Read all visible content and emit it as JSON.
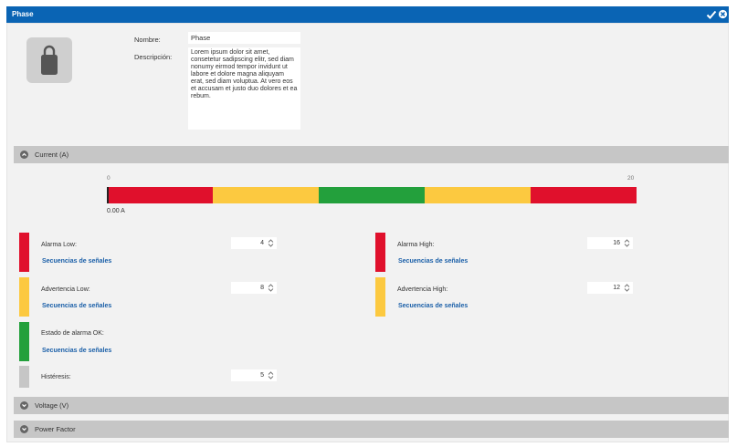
{
  "window": {
    "title": "Phase"
  },
  "colors": {
    "title_bar": "#0a64b4",
    "red": "#e0102c",
    "yellow": "#fcc940",
    "green": "#23a03c",
    "gray": "#c6c6c6",
    "link": "#1a5fa8"
  },
  "icons": {
    "device": "lock-icon",
    "confirm": "checkmark-icon",
    "close": "close-circle-icon",
    "expanded": "chevron-up-icon",
    "collapsed": "chevron-down-icon"
  },
  "form": {
    "name_label": "Nombre:",
    "name_value": "Phase",
    "description_label": "Descripción:",
    "description_value": "Lorem ipsum dolor sit amet, consetetur sadipscing elitr, sed diam nonumy eirmod tempor invidunt ut labore et dolore magna aliquyam erat, sed diam voluptua. At vero eos et accusam et justo duo dolores et ea rebum."
  },
  "sections": {
    "current": {
      "title": "Current (A)",
      "expanded": true
    },
    "voltage": {
      "title": "Voltage (V)",
      "expanded": false
    },
    "power_factor": {
      "title": "Power Factor",
      "expanded": false
    }
  },
  "gauge": {
    "min_label": "0",
    "max_label": "20",
    "current_value": "0.00 A",
    "segments": [
      "red",
      "yellow",
      "green",
      "yellow",
      "red"
    ]
  },
  "thresholds": {
    "alarm_low": {
      "label": "Alarma Low:",
      "value": "4",
      "link": "Secuencias de señales",
      "color": "red"
    },
    "alarm_high": {
      "label": "Alarma High:",
      "value": "16",
      "link": "Secuencias de señales",
      "color": "red"
    },
    "warning_low": {
      "label": "Advertencia Low:",
      "value": "8",
      "link": "Secuencias de señales",
      "color": "yellow"
    },
    "warning_high": {
      "label": "Advertencia High:",
      "value": "12",
      "link": "Secuencias de señales",
      "color": "yellow"
    },
    "alarm_ok": {
      "label": "Estado de alarma OK:",
      "link": "Secuencias de señales",
      "color": "green"
    },
    "hysteresis": {
      "label": "Histéresis:",
      "value": "5",
      "color": "gray"
    }
  }
}
